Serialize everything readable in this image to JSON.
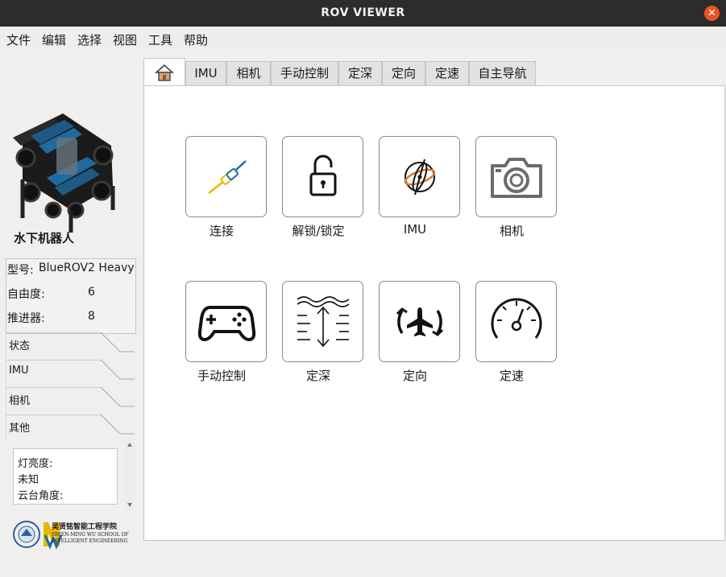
{
  "window": {
    "title": "ROV VIEWER",
    "close_icon": "close-icon"
  },
  "menu": [
    "文件",
    "编辑",
    "选择",
    "视图",
    "工具",
    "帮助"
  ],
  "left": {
    "robot_title": "水下机器人",
    "info": [
      {
        "label": "型号:",
        "value": "BlueROV2 Heavy"
      },
      {
        "label": "自由度:",
        "value": "6"
      },
      {
        "label": "推进器:",
        "value": "8"
      }
    ],
    "sections": [
      "状态",
      "IMU",
      "相机",
      "其他"
    ],
    "status_lines": [
      "灯亮度:",
      "未知",
      "云台角度:"
    ],
    "school_name_lines": [
      "吴贤铭智能工程学院",
      "SHIEN-MING WU SCHOOL OF",
      "INTELLIGENT ENGINEERING"
    ]
  },
  "tabs": [
    {
      "label": "",
      "icon": "home-icon",
      "active": true
    },
    {
      "label": "IMU"
    },
    {
      "label": "相机"
    },
    {
      "label": "手动控制"
    },
    {
      "label": "定深"
    },
    {
      "label": "定向"
    },
    {
      "label": "定速"
    },
    {
      "label": "自主导航"
    }
  ],
  "tiles": [
    {
      "label": "连接",
      "icon": "connect-plug-icon"
    },
    {
      "label": "解锁/锁定",
      "icon": "unlock-padlock-icon"
    },
    {
      "label": "IMU",
      "icon": "gyroscope-icon"
    },
    {
      "label": "相机",
      "icon": "camera-icon"
    },
    {
      "label": "手动控制",
      "icon": "gamepad-icon"
    },
    {
      "label": "定深",
      "icon": "depth-hold-icon"
    },
    {
      "label": "定向",
      "icon": "heading-hold-icon"
    },
    {
      "label": "定速",
      "icon": "speedometer-icon"
    }
  ],
  "colors": {
    "titlebar": "#2c2c2c",
    "close": "#e95420",
    "accent_blue": "#1f6aa0",
    "accent_yellow": "#e6b800",
    "gyro_orange": "#e07a2a"
  }
}
